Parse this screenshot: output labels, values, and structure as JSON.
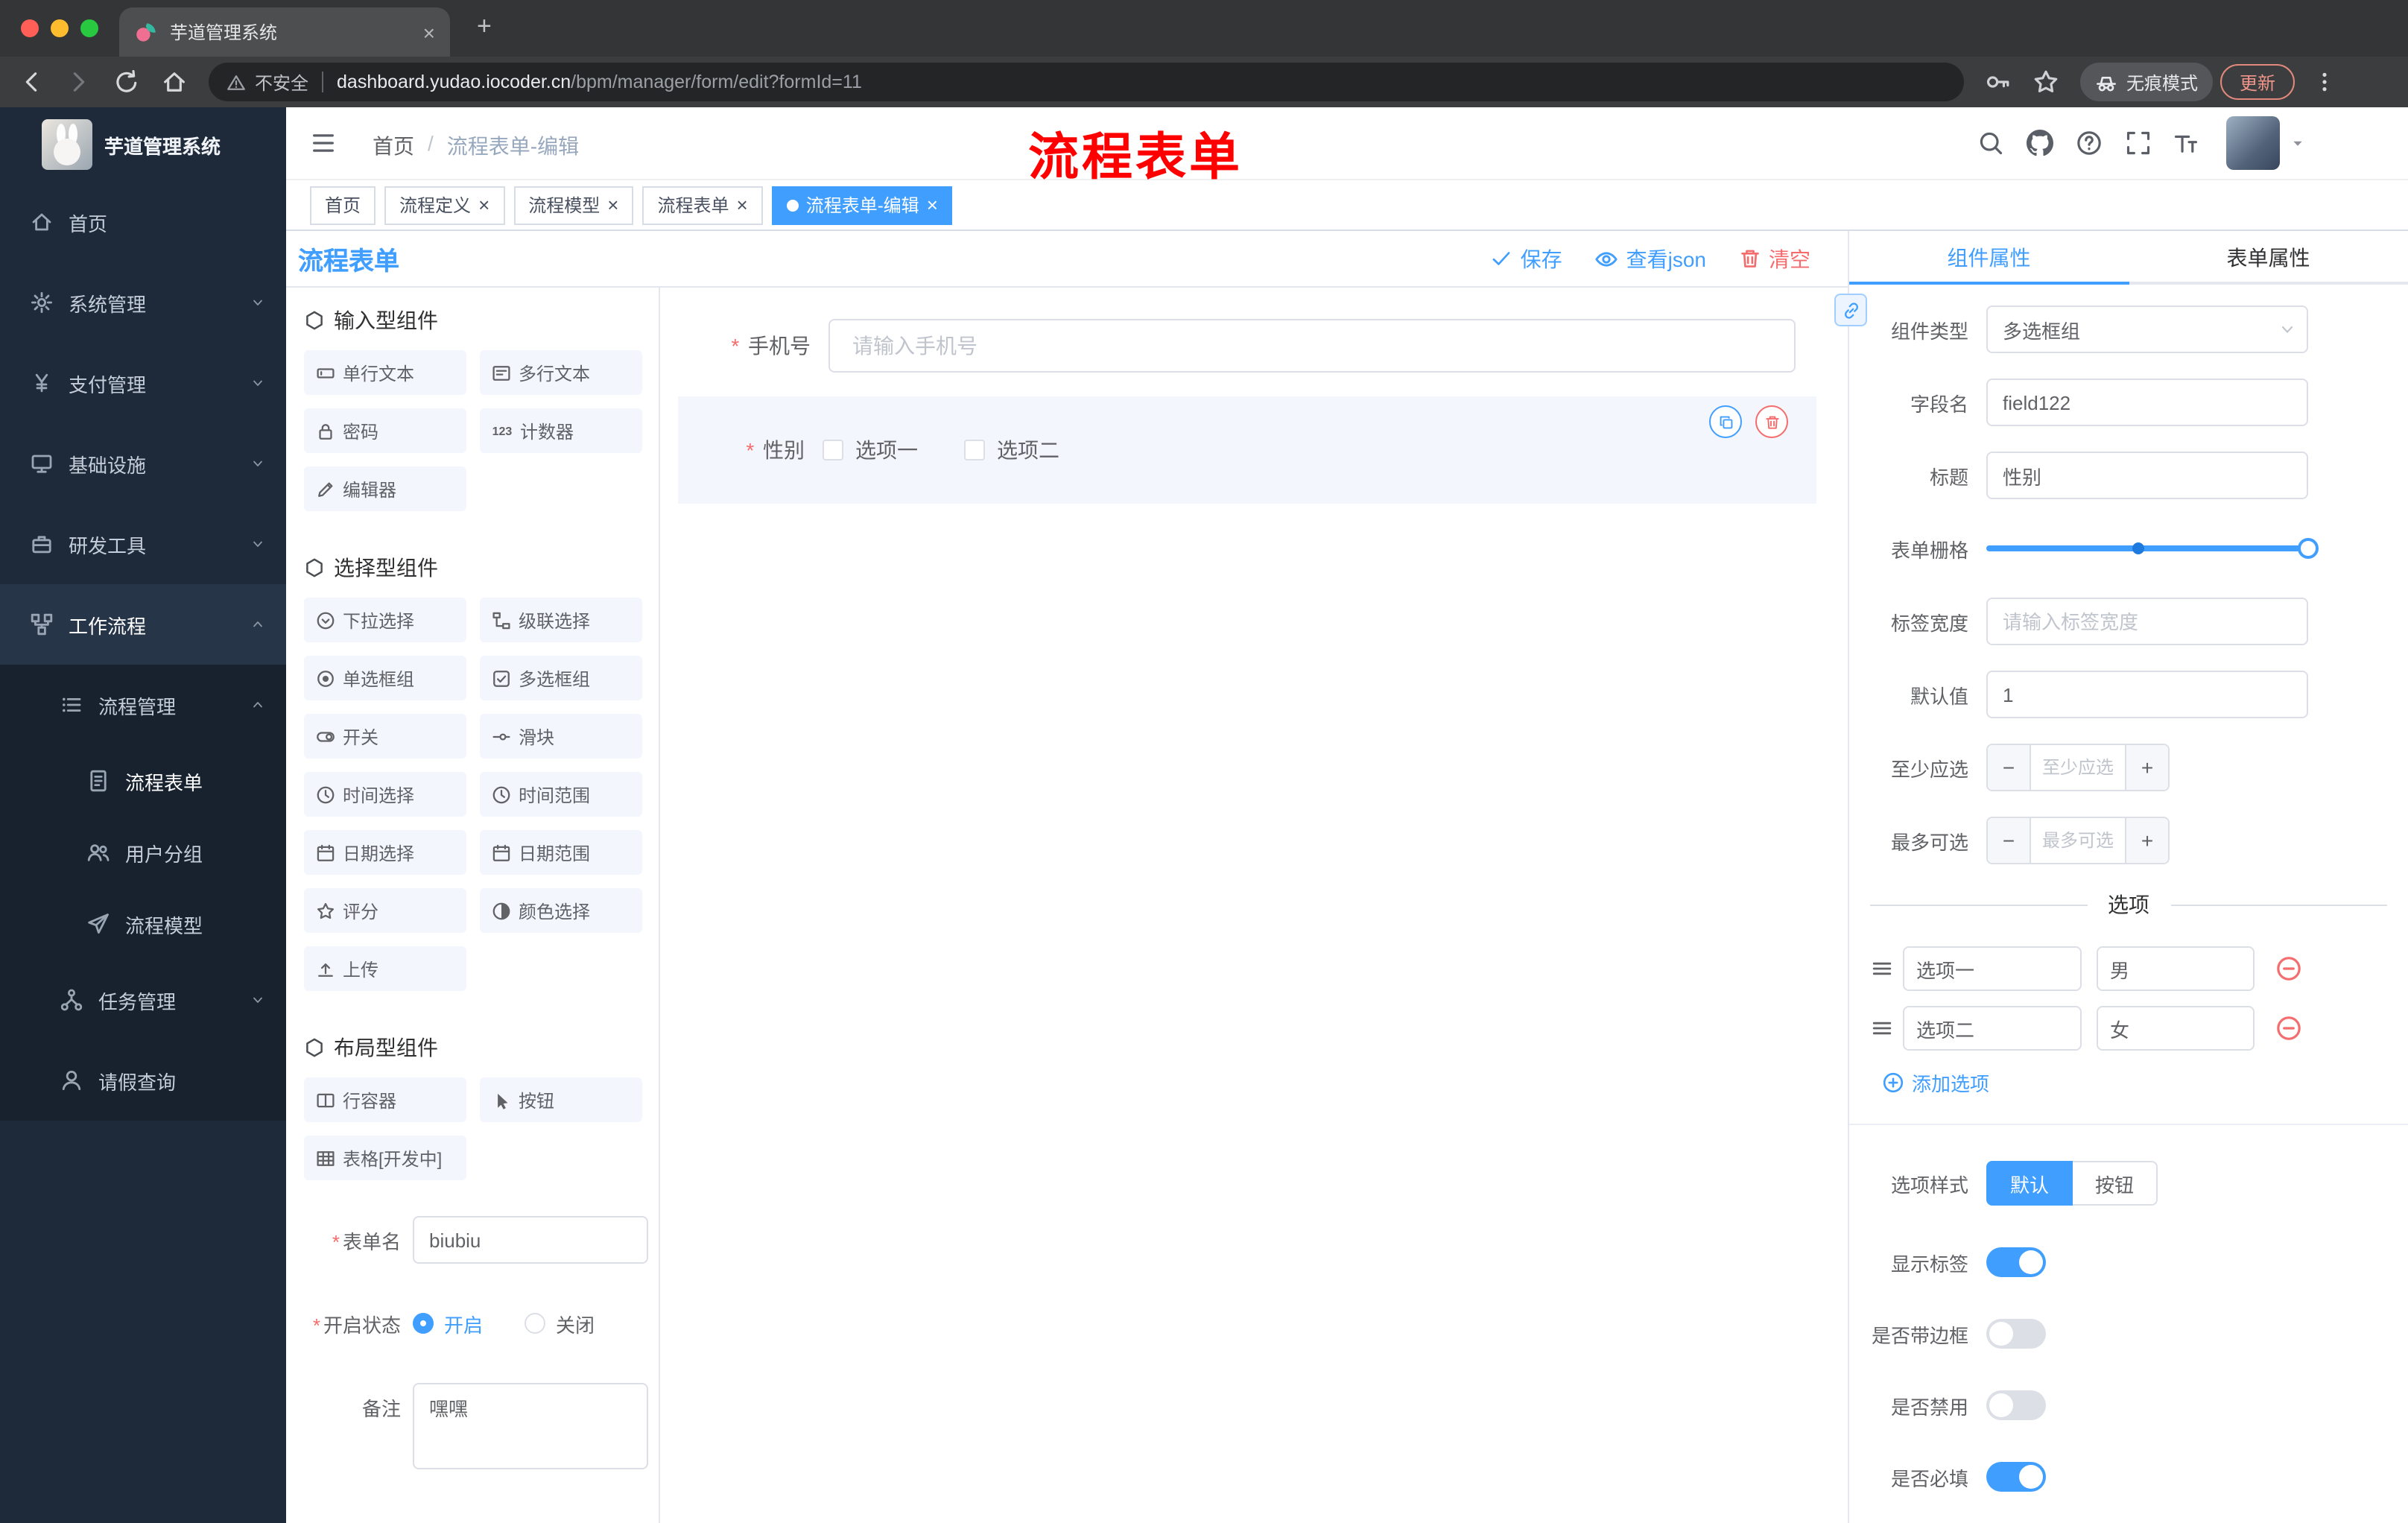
{
  "browser": {
    "tab": {
      "title": "芋道管理系统"
    },
    "nav": {
      "url_security": "不安全",
      "url_host": "dashboard.yudao.iocoder.cn",
      "url_path": "/bpm/manager/form/edit?formId=11",
      "incognito_label": "无痕模式",
      "update_label": "更新"
    }
  },
  "sidebar": {
    "logo_title": "芋道管理系统",
    "menu": [
      {
        "label": "首页"
      },
      {
        "label": "系统管理"
      },
      {
        "label": "支付管理"
      },
      {
        "label": "基础设施"
      },
      {
        "label": "研发工具"
      },
      {
        "label": "工作流程"
      },
      {
        "label": "流程管理"
      },
      {
        "label": "流程表单"
      },
      {
        "label": "用户分组"
      },
      {
        "label": "流程模型"
      },
      {
        "label": "任务管理"
      },
      {
        "label": "请假查询"
      }
    ]
  },
  "header": {
    "breadcrumb_home": "首页",
    "breadcrumb_current": "流程表单-编辑",
    "overlay_title": "流程表单"
  },
  "tagsview": [
    {
      "label": "首页"
    },
    {
      "label": "流程定义"
    },
    {
      "label": "流程模型"
    },
    {
      "label": "流程表单"
    },
    {
      "label": "流程表单-编辑"
    }
  ],
  "designer": {
    "title": "流程表单",
    "save": "保存",
    "view_json": "查看json",
    "clear": "清空"
  },
  "palette": {
    "section_input": "输入型组件",
    "input_items": [
      "单行文本",
      "多行文本",
      "密码",
      "计数器",
      "编辑器"
    ],
    "section_select": "选择型组件",
    "select_items": [
      "下拉选择",
      "级联选择",
      "单选框组",
      "多选框组",
      "开关",
      "滑块",
      "时间选择",
      "时间范围",
      "日期选择",
      "日期范围",
      "评分",
      "颜色选择",
      "上传"
    ],
    "section_layout": "布局型组件",
    "layout_items": [
      "行容器",
      "按钮",
      "表格[开发中]"
    ]
  },
  "form_config": {
    "name_label": "表单名",
    "name_value": "biubiu",
    "status_label": "开启状态",
    "status_on": "开启",
    "status_off": "关闭",
    "remark_label": "备注",
    "remark_value": "嘿嘿"
  },
  "canvas": {
    "phone_label": "手机号",
    "phone_placeholder": "请输入手机号",
    "gender_label": "性别",
    "gender_option1": "选项一",
    "gender_option2": "选项二"
  },
  "props": {
    "tab_component": "组件属性",
    "tab_form": "表单属性",
    "component_type_label": "组件类型",
    "component_type_value": "多选框组",
    "field_label": "字段名",
    "field_value": "field122",
    "title_label": "标题",
    "title_value": "性别",
    "grid_label": "表单栅格",
    "label_width_label": "标签宽度",
    "label_width_placeholder": "请输入标签宽度",
    "default_label": "默认值",
    "default_value": "1",
    "min_label": "至少应选",
    "min_placeholder": "至少应选",
    "max_label": "最多可选",
    "max_placeholder": "最多可选",
    "options_title": "选项",
    "options": [
      {
        "label": "选项一",
        "value": "男"
      },
      {
        "label": "选项二",
        "value": "女"
      }
    ],
    "add_option": "添加选项",
    "style_label": "选项样式",
    "style_default": "默认",
    "style_button": "按钮",
    "toggle_show_label": "显示标签",
    "toggle_border": "是否带边框",
    "toggle_disabled": "是否禁用",
    "toggle_required": "是否必填"
  },
  "glyphs": {
    "close": "×",
    "plus": "+",
    "minus": "−",
    "slash": "/",
    "asterisk": "*",
    "num123": "123"
  },
  "colors": {
    "accent": "#409eff",
    "danger": "#f56c6c"
  }
}
